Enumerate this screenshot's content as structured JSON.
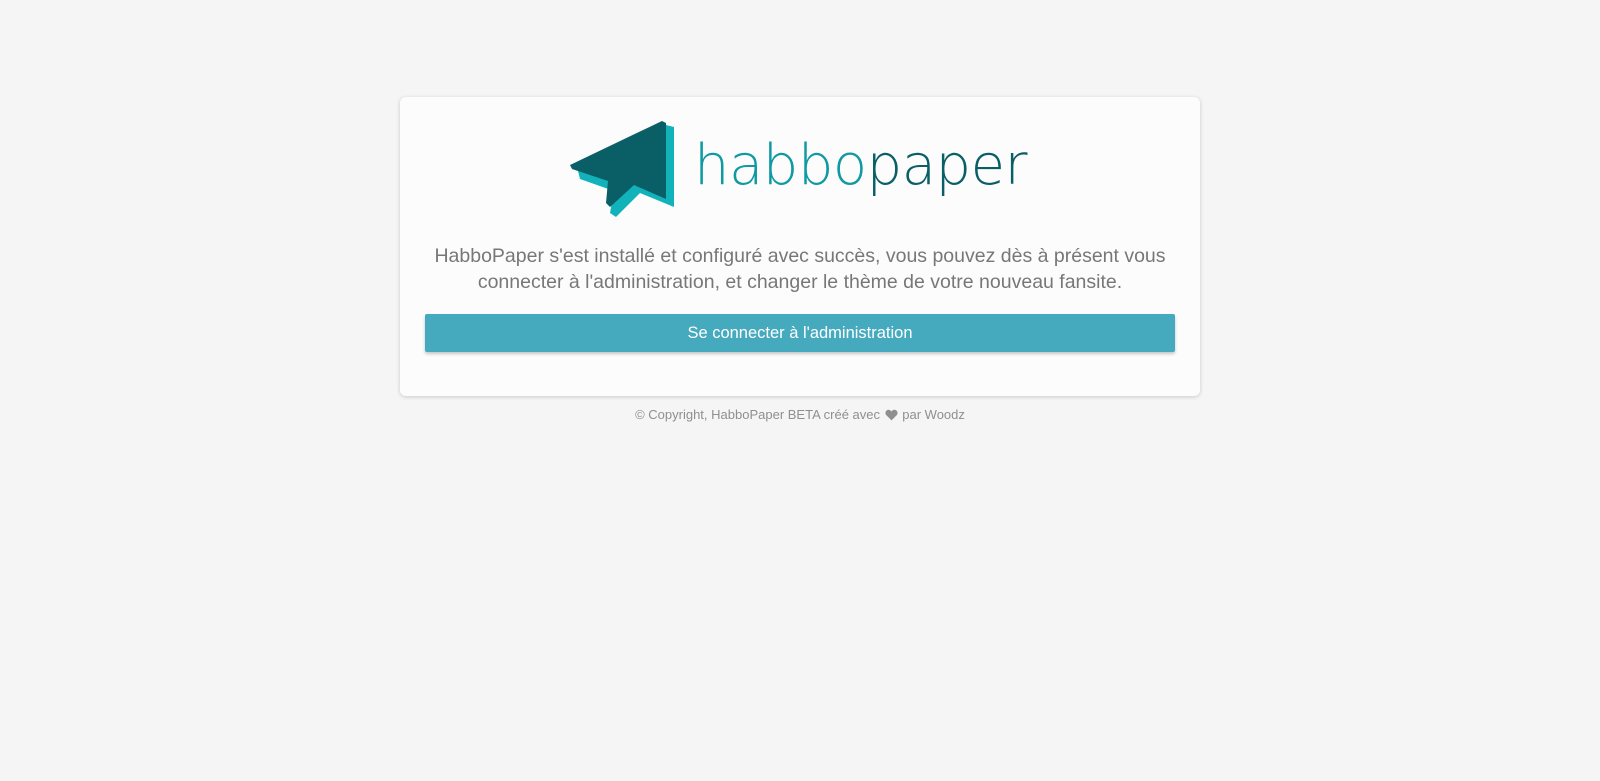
{
  "brand": {
    "name_part1": "habbo",
    "name_part2": "paper",
    "logo_icon": "paper-plane-speech-bubble-icon",
    "color_primary": "#0f9aa3",
    "color_dark": "#0a5f66"
  },
  "message": {
    "text": "HabboPaper s'est installé et configuré avec succès, vous pouvez dès à présent vous connecter à l'administration, et changer le thème de votre nouveau fansite."
  },
  "button": {
    "label": "Se connecter à l'administration",
    "color": "#45aabe"
  },
  "footer": {
    "prefix": "© Copyright, HabboPaper BETA créé avec",
    "icon": "heart-icon",
    "by": "par",
    "author": "Woodz"
  }
}
